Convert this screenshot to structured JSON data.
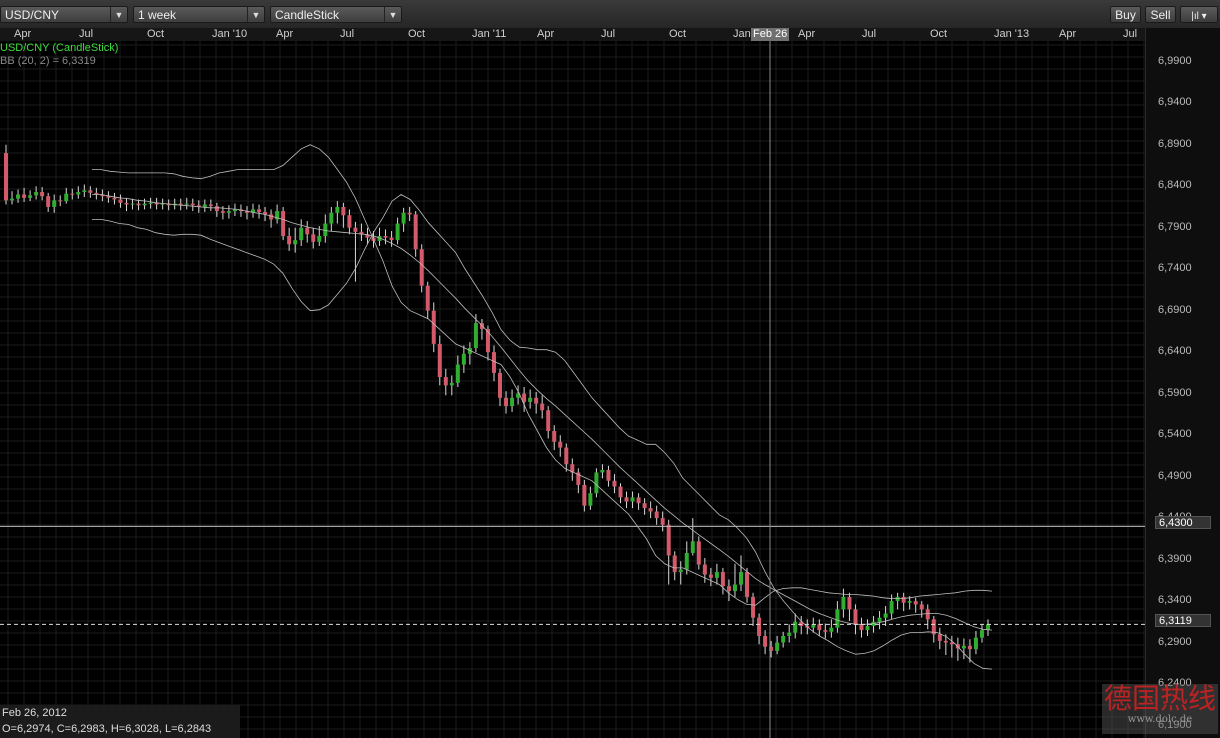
{
  "toolbar": {
    "symbol": "USD/CNY",
    "period": "1 week",
    "chart_type": "CandleStick",
    "buy_label": "Buy",
    "sell_label": "Sell",
    "icon": "chart-settings-icon"
  },
  "time_ticks": [
    {
      "label": "Apr",
      "x": 14
    },
    {
      "label": "Jul",
      "x": 79
    },
    {
      "label": "Oct",
      "x": 147
    },
    {
      "label": "Jan '10",
      "x": 212
    },
    {
      "label": "Apr",
      "x": 276
    },
    {
      "label": "Jul",
      "x": 340
    },
    {
      "label": "Oct",
      "x": 408
    },
    {
      "label": "Jan '11",
      "x": 472
    },
    {
      "label": "Apr",
      "x": 537
    },
    {
      "label": "Jul",
      "x": 601
    },
    {
      "label": "Oct",
      "x": 669
    },
    {
      "label": "Jan",
      "x": 733
    },
    {
      "label": "Apr",
      "x": 798
    },
    {
      "label": "Jul",
      "x": 862
    },
    {
      "label": "Oct",
      "x": 930
    },
    {
      "label": "Jan '13",
      "x": 994
    },
    {
      "label": "Apr",
      "x": 1059
    },
    {
      "label": "Jul",
      "x": 1123
    }
  ],
  "crosshair_date": "Feb 26",
  "legend": {
    "series": "USD/CNY (CandleStick)",
    "indicator": "BB (20, 2) = 6,3319"
  },
  "info": {
    "date": "Feb 26, 2012",
    "ohlc": "O=6,2974, C=6,2983, H=6,3028, L=6,2843"
  },
  "current_price": "6,3119",
  "crosshair_price": "6,4300",
  "watermark": {
    "text": "德国热线",
    "sub": "www.dolc.de"
  },
  "colors": {
    "up": "#2fae2f",
    "down": "#d35a6a",
    "band": "#bdbdbd",
    "grid": "#1c1c1c",
    "background": "#000000"
  },
  "chart_data": {
    "type": "candlestick",
    "title": "USD/CNY (CandleStick)",
    "indicator": "BB (20, 2)",
    "y_ticks": [
      "6,9900",
      "6,9400",
      "6,8900",
      "6,8400",
      "6,7900",
      "6,7400",
      "6,6900",
      "6,6400",
      "6,5900",
      "6,5400",
      "6,4900",
      "6,4400",
      "6,3900",
      "6,3400",
      "6,2900",
      "6,2400",
      "6,1900"
    ],
    "ylim": [
      6.175,
      7.015
    ],
    "period": "1 week",
    "first_week": "2009-03-02",
    "last_week": "2012-10-01",
    "candles": [
      [
        6.88,
        6.823,
        6.89,
        6.818
      ],
      [
        6.823,
        6.825,
        6.834,
        6.818
      ],
      [
        6.825,
        6.83,
        6.836,
        6.82
      ],
      [
        6.83,
        6.826,
        6.838,
        6.821
      ],
      [
        6.826,
        6.829,
        6.835,
        6.822
      ],
      [
        6.829,
        6.833,
        6.84,
        6.824
      ],
      [
        6.833,
        6.828,
        6.839,
        6.823
      ],
      [
        6.828,
        6.815,
        6.832,
        6.809
      ],
      [
        6.815,
        6.823,
        6.83,
        6.808
      ],
      [
        6.823,
        6.822,
        6.829,
        6.816
      ],
      [
        6.822,
        6.831,
        6.838,
        6.819
      ],
      [
        6.831,
        6.83,
        6.837,
        6.824
      ],
      [
        6.83,
        6.833,
        6.84,
        6.825
      ],
      [
        6.833,
        6.835,
        6.842,
        6.827
      ],
      [
        6.835,
        6.832,
        6.84,
        6.826
      ],
      [
        6.832,
        6.83,
        6.838,
        6.824
      ],
      [
        6.83,
        6.828,
        6.836,
        6.822
      ],
      [
        6.828,
        6.826,
        6.834,
        6.82
      ],
      [
        6.826,
        6.824,
        6.832,
        6.818
      ],
      [
        6.824,
        6.82,
        6.83,
        6.814
      ],
      [
        6.82,
        6.818,
        6.826,
        6.81
      ],
      [
        6.818,
        6.819,
        6.825,
        6.812
      ],
      [
        6.819,
        6.817,
        6.824,
        6.811
      ],
      [
        6.817,
        6.819,
        6.825,
        6.812
      ],
      [
        6.819,
        6.82,
        6.826,
        6.813
      ],
      [
        6.82,
        6.818,
        6.826,
        6.812
      ],
      [
        6.818,
        6.819,
        6.825,
        6.812
      ],
      [
        6.819,
        6.817,
        6.824,
        6.811
      ],
      [
        6.817,
        6.819,
        6.825,
        6.812
      ],
      [
        6.819,
        6.818,
        6.825,
        6.811
      ],
      [
        6.818,
        6.819,
        6.826,
        6.812
      ],
      [
        6.819,
        6.817,
        6.825,
        6.81
      ],
      [
        6.817,
        6.815,
        6.823,
        6.808
      ],
      [
        6.815,
        6.818,
        6.824,
        6.809
      ],
      [
        6.818,
        6.816,
        6.824,
        6.81
      ],
      [
        6.816,
        6.81,
        6.82,
        6.803
      ],
      [
        6.81,
        6.808,
        6.816,
        6.8
      ],
      [
        6.808,
        6.81,
        6.817,
        6.801
      ],
      [
        6.81,
        6.812,
        6.819,
        6.804
      ],
      [
        6.812,
        6.81,
        6.818,
        6.803
      ],
      [
        6.81,
        6.808,
        6.816,
        6.8
      ],
      [
        6.808,
        6.812,
        6.819,
        6.802
      ],
      [
        6.812,
        6.809,
        6.818,
        6.801
      ],
      [
        6.809,
        6.806,
        6.815,
        6.798
      ],
      [
        6.806,
        6.8,
        6.812,
        6.79
      ],
      [
        6.8,
        6.81,
        6.818,
        6.795
      ],
      [
        6.81,
        6.78,
        6.815,
        6.775
      ],
      [
        6.78,
        6.77,
        6.79,
        6.762
      ],
      [
        6.77,
        6.775,
        6.79,
        6.76
      ],
      [
        6.775,
        6.79,
        6.8,
        6.768
      ],
      [
        6.79,
        6.782,
        6.798,
        6.772
      ],
      [
        6.782,
        6.773,
        6.79,
        6.765
      ],
      [
        6.773,
        6.78,
        6.792,
        6.768
      ],
      [
        6.78,
        6.795,
        6.806,
        6.772
      ],
      [
        6.795,
        6.808,
        6.815,
        6.786
      ],
      [
        6.808,
        6.815,
        6.822,
        6.795
      ],
      [
        6.815,
        6.805,
        6.82,
        6.79
      ],
      [
        6.805,
        6.79,
        6.812,
        6.782
      ],
      [
        6.79,
        6.785,
        6.797,
        6.725
      ],
      [
        6.785,
        6.782,
        6.795,
        6.774
      ],
      [
        6.782,
        6.778,
        6.79,
        6.77
      ],
      [
        6.778,
        6.774,
        6.786,
        6.766
      ],
      [
        6.774,
        6.78,
        6.79,
        6.768
      ],
      [
        6.78,
        6.778,
        6.788,
        6.77
      ],
      [
        6.778,
        6.775,
        6.786,
        6.767
      ],
      [
        6.775,
        6.795,
        6.802,
        6.77
      ],
      [
        6.795,
        6.808,
        6.814,
        6.785
      ],
      [
        6.808,
        6.806,
        6.815,
        6.798
      ],
      [
        6.806,
        6.764,
        6.81,
        6.755
      ],
      [
        6.764,
        6.72,
        6.77,
        6.712
      ],
      [
        6.72,
        6.69,
        6.725,
        6.68
      ],
      [
        6.69,
        6.65,
        6.7,
        6.64
      ],
      [
        6.65,
        6.61,
        6.66,
        6.6
      ],
      [
        6.61,
        6.6,
        6.62,
        6.588
      ],
      [
        6.6,
        6.603,
        6.612,
        6.588
      ],
      [
        6.603,
        6.625,
        6.636,
        6.598
      ],
      [
        6.625,
        6.638,
        6.648,
        6.615
      ],
      [
        6.638,
        6.645,
        6.652,
        6.625
      ],
      [
        6.645,
        6.675,
        6.686,
        6.64
      ],
      [
        6.675,
        6.668,
        6.68,
        6.655
      ],
      [
        6.668,
        6.64,
        6.672,
        6.63
      ],
      [
        6.64,
        6.615,
        6.648,
        6.605
      ],
      [
        6.615,
        6.585,
        6.62,
        6.575
      ],
      [
        6.585,
        6.575,
        6.593,
        6.566
      ],
      [
        6.575,
        6.585,
        6.595,
        6.568
      ],
      [
        6.585,
        6.59,
        6.6,
        6.577
      ],
      [
        6.59,
        6.58,
        6.598,
        6.568
      ],
      [
        6.58,
        6.585,
        6.595,
        6.572
      ],
      [
        6.585,
        6.578,
        6.592,
        6.566
      ],
      [
        6.578,
        6.57,
        6.588,
        6.56
      ],
      [
        6.57,
        6.545,
        6.575,
        6.536
      ],
      [
        6.545,
        6.532,
        6.552,
        6.522
      ],
      [
        6.532,
        6.525,
        6.54,
        6.514
      ],
      [
        6.525,
        6.505,
        6.53,
        6.496
      ],
      [
        6.505,
        6.495,
        6.512,
        6.485
      ],
      [
        6.495,
        6.48,
        6.5,
        6.47
      ],
      [
        6.48,
        6.455,
        6.486,
        6.448
      ],
      [
        6.455,
        6.47,
        6.478,
        6.45
      ],
      [
        6.47,
        6.495,
        6.5,
        6.465
      ],
      [
        6.495,
        6.498,
        6.505,
        6.488
      ],
      [
        6.498,
        6.485,
        6.503,
        6.478
      ],
      [
        6.485,
        6.478,
        6.493,
        6.47
      ],
      [
        6.478,
        6.465,
        6.482,
        6.458
      ],
      [
        6.465,
        6.46,
        6.472,
        6.452
      ],
      [
        6.46,
        6.465,
        6.472,
        6.452
      ],
      [
        6.465,
        6.458,
        6.47,
        6.45
      ],
      [
        6.458,
        6.452,
        6.464,
        6.444
      ],
      [
        6.452,
        6.448,
        6.46,
        6.44
      ],
      [
        6.448,
        6.44,
        6.455,
        6.432
      ],
      [
        6.44,
        6.432,
        6.448,
        6.424
      ],
      [
        6.432,
        6.395,
        6.438,
        6.36
      ],
      [
        6.395,
        6.375,
        6.4,
        6.365
      ],
      [
        6.375,
        6.378,
        6.388,
        6.36
      ],
      [
        6.378,
        6.398,
        6.412,
        6.372
      ],
      [
        6.398,
        6.412,
        6.44,
        6.395
      ],
      [
        6.412,
        6.384,
        6.418,
        6.378
      ],
      [
        6.384,
        6.372,
        6.392,
        6.362
      ],
      [
        6.372,
        6.368,
        6.38,
        6.358
      ],
      [
        6.368,
        6.375,
        6.385,
        6.36
      ],
      [
        6.375,
        6.358,
        6.38,
        6.348
      ],
      [
        6.358,
        6.352,
        6.366,
        6.34
      ],
      [
        6.352,
        6.36,
        6.385,
        6.345
      ],
      [
        6.36,
        6.375,
        6.395,
        6.352
      ],
      [
        6.375,
        6.345,
        6.38,
        6.338
      ],
      [
        6.345,
        6.32,
        6.35,
        6.31
      ],
      [
        6.32,
        6.298,
        6.325,
        6.288
      ],
      [
        6.298,
        6.285,
        6.305,
        6.276
      ],
      [
        6.285,
        6.28,
        6.292,
        6.272
      ],
      [
        6.28,
        6.29,
        6.298,
        6.276
      ],
      [
        6.29,
        6.298,
        6.303,
        6.284
      ],
      [
        6.298,
        6.302,
        6.312,
        6.29
      ],
      [
        6.302,
        6.315,
        6.325,
        6.295
      ],
      [
        6.315,
        6.31,
        6.322,
        6.3
      ],
      [
        6.31,
        6.308,
        6.318,
        6.3
      ],
      [
        6.308,
        6.312,
        6.32,
        6.302
      ],
      [
        6.312,
        6.305,
        6.318,
        6.298
      ],
      [
        6.305,
        6.303,
        6.313,
        6.295
      ],
      [
        6.303,
        6.308,
        6.318,
        6.296
      ],
      [
        6.308,
        6.33,
        6.34,
        6.302
      ],
      [
        6.33,
        6.345,
        6.355,
        6.32
      ],
      [
        6.345,
        6.33,
        6.35,
        6.316
      ],
      [
        6.33,
        6.312,
        6.336,
        6.3
      ],
      [
        6.312,
        6.305,
        6.32,
        6.296
      ],
      [
        6.305,
        6.31,
        6.318,
        6.298
      ],
      [
        6.31,
        6.315,
        6.322,
        6.302
      ],
      [
        6.315,
        6.32,
        6.328,
        6.306
      ],
      [
        6.32,
        6.325,
        6.334,
        6.31
      ],
      [
        6.325,
        6.34,
        6.348,
        6.318
      ],
      [
        6.34,
        6.345,
        6.35,
        6.33
      ],
      [
        6.345,
        6.338,
        6.35,
        6.328
      ],
      [
        6.338,
        6.34,
        6.346,
        6.33
      ],
      [
        6.34,
        6.336,
        6.344,
        6.326
      ],
      [
        6.336,
        6.33,
        6.34,
        6.32
      ],
      [
        6.33,
        6.318,
        6.336,
        6.306
      ],
      [
        6.318,
        6.3,
        6.322,
        6.29
      ],
      [
        6.3,
        6.292,
        6.308,
        6.282
      ],
      [
        6.292,
        6.29,
        6.3,
        6.275
      ],
      [
        6.29,
        6.288,
        6.298,
        6.272
      ],
      [
        6.288,
        6.283,
        6.296,
        6.268
      ],
      [
        6.283,
        6.286,
        6.295,
        6.27
      ],
      [
        6.286,
        6.282,
        6.294,
        6.266
      ],
      [
        6.282,
        6.296,
        6.304,
        6.276
      ],
      [
        6.296,
        6.305,
        6.312,
        6.29
      ],
      [
        6.305,
        6.312,
        6.318,
        6.298
      ]
    ],
    "bands": {
      "mid": [
        6.83,
        6.83,
        6.828,
        6.826,
        6.825,
        6.823,
        6.822,
        6.82,
        6.819,
        6.818,
        6.817,
        6.816,
        6.815,
        6.814,
        6.814,
        6.813,
        6.812,
        6.81,
        6.808,
        6.806,
        6.803,
        6.8,
        6.796,
        6.793,
        6.79,
        6.788,
        6.786,
        6.785,
        6.784,
        6.783,
        6.782,
        6.78,
        6.776,
        6.771,
        6.765,
        6.757,
        6.748,
        6.738,
        6.727,
        6.716,
        6.705,
        6.693,
        6.682,
        6.671,
        6.659,
        6.646,
        6.632,
        6.618,
        6.605,
        6.594,
        6.584,
        6.575,
        6.565,
        6.555,
        6.545,
        6.535,
        6.524,
        6.513,
        6.502,
        6.492,
        6.482,
        6.472,
        6.462,
        6.452,
        6.443,
        6.434,
        6.426,
        6.418,
        6.41,
        6.402,
        6.394,
        6.385,
        6.376,
        6.367,
        6.36,
        6.354,
        6.348,
        6.342,
        6.336,
        6.33,
        6.325,
        6.321,
        6.317,
        6.314,
        6.312,
        6.312,
        6.313,
        6.315,
        6.318,
        6.321,
        6.323,
        6.324,
        6.325,
        6.325,
        6.323,
        6.319,
        6.314,
        6.309,
        6.306,
        6.305
      ],
      "upper": [
        6.86,
        6.86,
        6.858,
        6.857,
        6.856,
        6.856,
        6.856,
        6.856,
        6.856,
        6.855,
        6.852,
        6.85,
        6.849,
        6.852,
        6.856,
        6.858,
        6.86,
        6.86,
        6.86,
        6.86,
        6.86,
        6.865,
        6.875,
        6.885,
        6.89,
        6.885,
        6.875,
        6.86,
        6.845,
        6.825,
        6.8,
        6.775,
        6.75,
        6.72,
        6.7,
        6.69,
        6.685,
        6.68,
        6.67,
        6.66,
        6.65,
        6.645,
        6.64,
        6.635,
        6.63,
        6.625,
        6.61,
        6.59,
        6.565,
        6.545,
        6.525,
        6.51,
        6.5,
        6.495,
        6.49,
        6.485,
        6.475,
        6.465,
        6.455,
        6.445,
        6.43,
        6.415,
        6.395,
        6.385,
        6.38,
        6.38,
        6.375,
        6.37,
        6.365,
        6.36,
        6.35,
        6.342,
        6.336,
        6.335,
        6.344,
        6.352,
        6.355,
        6.356,
        6.356,
        6.354,
        6.352,
        6.35,
        6.349,
        6.348,
        6.348,
        6.347,
        6.346,
        6.344,
        6.343,
        6.343,
        6.344,
        6.346,
        6.347,
        6.348,
        6.349,
        6.35,
        6.352,
        6.353,
        6.353,
        6.352
      ],
      "lower": [
        6.8,
        6.8,
        6.798,
        6.795,
        6.794,
        6.79,
        6.788,
        6.784,
        6.782,
        6.781,
        6.782,
        6.782,
        6.781,
        6.776,
        6.772,
        6.768,
        6.764,
        6.76,
        6.756,
        6.752,
        6.746,
        6.735,
        6.717,
        6.701,
        6.69,
        6.691,
        6.697,
        6.71,
        6.723,
        6.741,
        6.764,
        6.785,
        6.802,
        6.822,
        6.83,
        6.824,
        6.811,
        6.796,
        6.784,
        6.772,
        6.76,
        6.741,
        6.724,
        6.707,
        6.688,
        6.667,
        6.654,
        6.646,
        6.645,
        6.643,
        6.643,
        6.64,
        6.63,
        6.615,
        6.6,
        6.585,
        6.573,
        6.561,
        6.549,
        6.539,
        6.534,
        6.529,
        6.529,
        6.519,
        6.506,
        6.488,
        6.477,
        6.466,
        6.455,
        6.444,
        6.438,
        6.428,
        6.416,
        6.399,
        6.376,
        6.356,
        6.341,
        6.328,
        6.316,
        6.306,
        6.298,
        6.292,
        6.285,
        6.28,
        6.276,
        6.277,
        6.28,
        6.286,
        6.293,
        6.299,
        6.302,
        6.302,
        6.303,
        6.302,
        6.297,
        6.288,
        6.276,
        6.265,
        6.259,
        6.258
      ]
    }
  }
}
